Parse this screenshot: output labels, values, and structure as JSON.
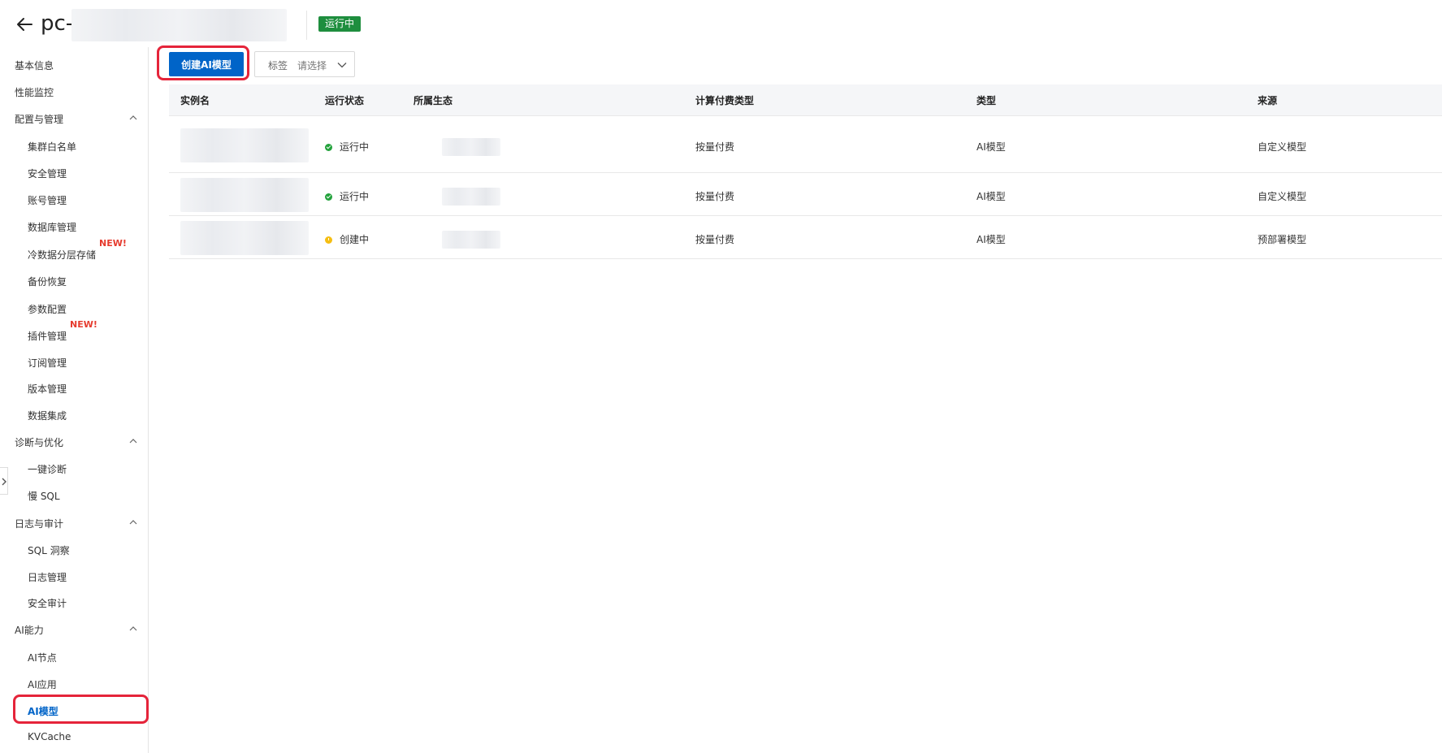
{
  "header": {
    "title": "pc-",
    "status_badge": "运行中"
  },
  "sidebar": {
    "items": [
      {
        "label": "基本信息",
        "level": 1
      },
      {
        "label": "性能监控",
        "level": 1
      },
      {
        "label": "配置与管理",
        "level": 1,
        "expanded": true
      },
      {
        "label": "集群白名单",
        "level": 2
      },
      {
        "label": "安全管理",
        "level": 2
      },
      {
        "label": "账号管理",
        "level": 2
      },
      {
        "label": "数据库管理",
        "level": 2
      },
      {
        "label": "冷数据分层存储",
        "level": 2,
        "badge": "NEW!"
      },
      {
        "label": "备份恢复",
        "level": 2
      },
      {
        "label": "参数配置",
        "level": 2
      },
      {
        "label": "插件管理",
        "level": 2,
        "badge": "NEW!"
      },
      {
        "label": "订阅管理",
        "level": 2
      },
      {
        "label": "版本管理",
        "level": 2
      },
      {
        "label": "数据集成",
        "level": 2
      },
      {
        "label": "诊断与优化",
        "level": 1,
        "expanded": true
      },
      {
        "label": "一键诊断",
        "level": 2
      },
      {
        "label": "慢 SQL",
        "level": 2
      },
      {
        "label": "日志与审计",
        "level": 1,
        "expanded": true
      },
      {
        "label": "SQL 洞察",
        "level": 2
      },
      {
        "label": "日志管理",
        "level": 2
      },
      {
        "label": "安全审计",
        "level": 2
      },
      {
        "label": "AI能力",
        "level": 1,
        "expanded": true
      },
      {
        "label": "AI节点",
        "level": 2
      },
      {
        "label": "AI应用",
        "level": 2
      },
      {
        "label": "AI模型",
        "level": 2,
        "active": true
      },
      {
        "label": "KVCache",
        "level": 2
      }
    ]
  },
  "toolbar": {
    "create_button_label": "创建AI模型",
    "tag_filter_label": "标签",
    "tag_filter_placeholder": "请选择"
  },
  "table": {
    "columns": [
      "实例名",
      "运行状态",
      "所属生态",
      "计算付费类型",
      "类型",
      "来源"
    ],
    "rows": [
      {
        "status": "运行中",
        "status_type": "success",
        "billing": "按量付费",
        "type": "AI模型",
        "source": "自定义模型"
      },
      {
        "status": "运行中",
        "status_type": "success",
        "billing": "按量付费",
        "type": "AI模型",
        "source": "自定义模型"
      },
      {
        "status": "创建中",
        "status_type": "warning",
        "billing": "按量付费",
        "type": "AI模型",
        "source": "预部署模型"
      }
    ]
  },
  "colors": {
    "primary": "#0064c8",
    "running_badge": "#1e8e3e",
    "success": "#23a23c",
    "warning": "#f5be12",
    "highlight_outline": "#e5243a",
    "new_badge": "#e63b2e"
  }
}
